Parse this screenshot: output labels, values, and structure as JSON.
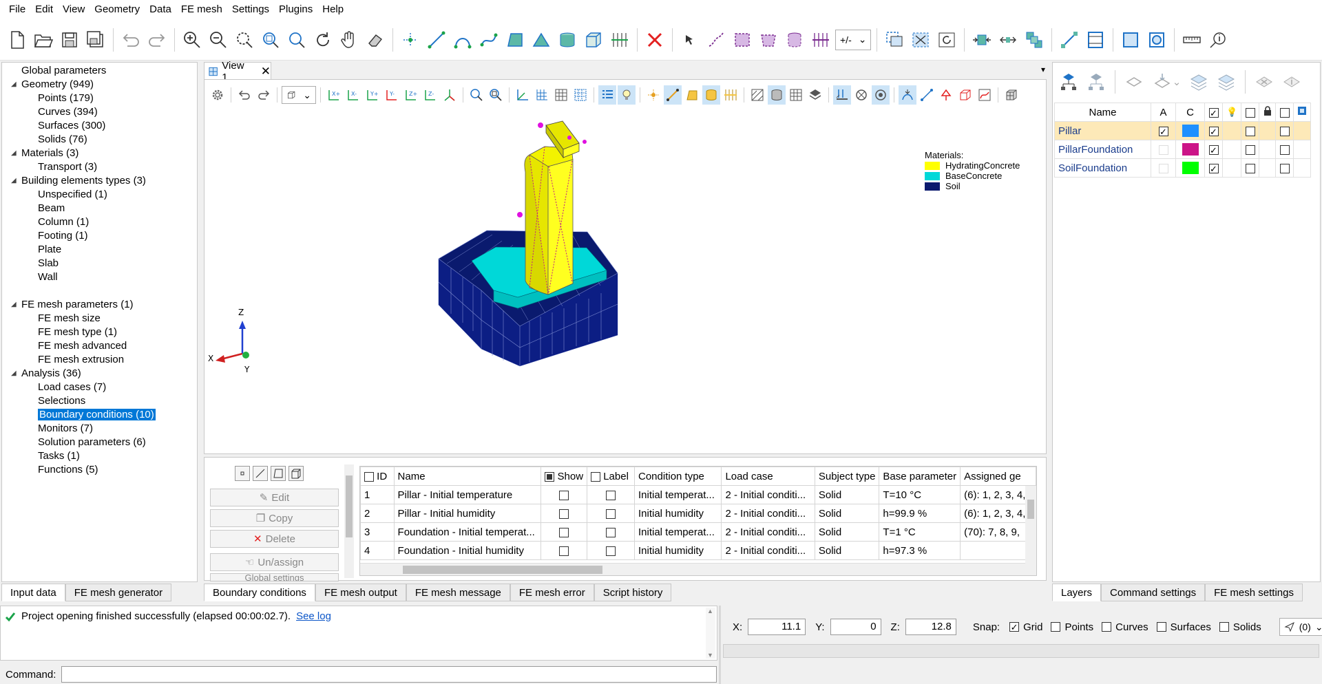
{
  "menu": [
    "File",
    "Edit",
    "View",
    "Geometry",
    "Data",
    "FE mesh",
    "Settings",
    "Plugins",
    "Help"
  ],
  "toolbar": {
    "sign_dropdown": "+/-"
  },
  "tree": [
    {
      "label": "Global parameters",
      "level": 0,
      "arrow": false
    },
    {
      "label": "Geometry (949)",
      "level": 0,
      "arrow": true
    },
    {
      "label": "Points (179)",
      "level": 1
    },
    {
      "label": "Curves (394)",
      "level": 1
    },
    {
      "label": "Surfaces (300)",
      "level": 1
    },
    {
      "label": "Solids (76)",
      "level": 1
    },
    {
      "label": "Materials (3)",
      "level": 0,
      "arrow": true
    },
    {
      "label": "Transport (3)",
      "level": 1
    },
    {
      "label": "Building elements types (3)",
      "level": 0,
      "arrow": true
    },
    {
      "label": "Unspecified (1)",
      "level": 1
    },
    {
      "label": "Beam",
      "level": 1
    },
    {
      "label": "Column (1)",
      "level": 1
    },
    {
      "label": "Footing (1)",
      "level": 1
    },
    {
      "label": "Plate",
      "level": 1
    },
    {
      "label": "Slab",
      "level": 1
    },
    {
      "label": "Wall",
      "level": 1
    },
    {
      "label": "",
      "level": 1
    },
    {
      "label": "FE mesh parameters (1)",
      "level": 0,
      "arrow": true
    },
    {
      "label": "FE mesh size",
      "level": 1
    },
    {
      "label": "FE mesh type (1)",
      "level": 1
    },
    {
      "label": "FE mesh advanced",
      "level": 1
    },
    {
      "label": "FE mesh extrusion",
      "level": 1
    },
    {
      "label": "Analysis (36)",
      "level": 0,
      "arrow": true
    },
    {
      "label": "Load cases (7)",
      "level": 1
    },
    {
      "label": "Selections",
      "level": 1
    },
    {
      "label": "Boundary conditions (10)",
      "level": 1,
      "selected": true
    },
    {
      "label": "Monitors (7)",
      "level": 1
    },
    {
      "label": "Solution parameters (6)",
      "level": 1
    },
    {
      "label": "Tasks (1)",
      "level": 1
    },
    {
      "label": "Functions (5)",
      "level": 1
    }
  ],
  "left_tabs": [
    "Input data",
    "FE mesh generator"
  ],
  "view_tab": "View 1",
  "legend": {
    "title": "Materials:",
    "items": [
      {
        "name": "HydratingConcrete",
        "color": "#ffff00"
      },
      {
        "name": "BaseConcrete",
        "color": "#00d8d8"
      },
      {
        "name": "Soil",
        "color": "#0a1a6e"
      }
    ]
  },
  "axes": {
    "x": "X",
    "y": "Y",
    "z": "Z"
  },
  "bc_actions": {
    "edit": "Edit",
    "copy": "Copy",
    "delete": "Delete",
    "unassign": "Un/assign",
    "global": "Global settings"
  },
  "bc_table": {
    "headers": [
      "ID",
      "Name",
      "Show",
      "Label",
      "Condition type",
      "Load case",
      "Subject type",
      "Base parameter",
      "Assigned ge"
    ],
    "rows": [
      {
        "id": "1",
        "name": "Pillar - Initial temperature",
        "cond": "Initial temperat...",
        "load": "2 - Initial conditi...",
        "subject": "Solid",
        "param": "T=10 °C",
        "assigned": "(6): 1, 2, 3, 4,"
      },
      {
        "id": "2",
        "name": "Pillar - Initial humidity",
        "cond": "Initial humidity",
        "load": "2 - Initial conditi...",
        "subject": "Solid",
        "param": "h=99.9 %",
        "assigned": "(6): 1, 2, 3, 4,"
      },
      {
        "id": "3",
        "name": "Foundation - Initial temperat...",
        "cond": "Initial temperat...",
        "load": "2 - Initial conditi...",
        "subject": "Solid",
        "param": "T=1 °C",
        "assigned": "(70): 7, 8, 9,"
      },
      {
        "id": "4",
        "name": "Foundation - Initial humidity",
        "cond": "Initial humidity",
        "load": "2 - Initial conditi...",
        "subject": "Solid",
        "param": "h=97.3 %",
        "assigned": ""
      }
    ]
  },
  "bottom_tabs": [
    "Boundary conditions",
    "FE mesh output",
    "FE mesh message",
    "FE mesh error",
    "Script history"
  ],
  "layers": {
    "headers": [
      "Name",
      "A",
      "C"
    ],
    "rows": [
      {
        "name": "Pillar",
        "active": true,
        "color": "#1e90ff",
        "visible": true
      },
      {
        "name": "PillarFoundation",
        "active": false,
        "color": "#cc1488",
        "visible": true
      },
      {
        "name": "SoilFoundation",
        "active": false,
        "color": "#00ff00",
        "visible": true
      }
    ]
  },
  "right_tabs": [
    "Layers",
    "Command settings",
    "FE mesh settings"
  ],
  "log": {
    "message": "Project opening finished successfully (elapsed 00:00:02.7).",
    "link": "See log"
  },
  "command": {
    "label": "Command:"
  },
  "coords": {
    "x_label": "X:",
    "x": "11.1",
    "y_label": "Y:",
    "y": "0",
    "z_label": "Z:",
    "z": "12.8"
  },
  "snap": {
    "label": "Snap:",
    "options": [
      {
        "name": "Grid",
        "checked": true
      },
      {
        "name": "Points",
        "checked": false
      },
      {
        "name": "Curves",
        "checked": false
      },
      {
        "name": "Surfaces",
        "checked": false
      },
      {
        "name": "Solids",
        "checked": false
      }
    ],
    "count": "(0)"
  }
}
